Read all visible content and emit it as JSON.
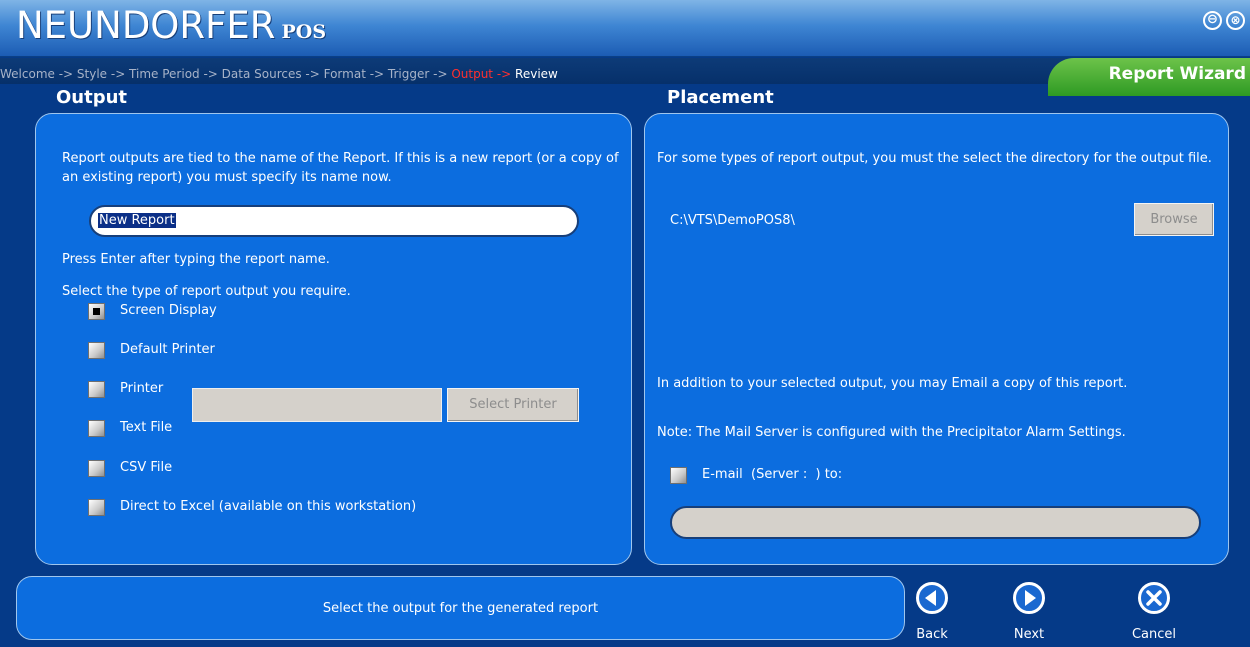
{
  "app": {
    "title": "NEUNDORFER",
    "subtitle": "POS"
  },
  "window_controls": {
    "minimize_glyph": "⊖",
    "close_glyph": "⊗"
  },
  "breadcrumb": {
    "steps_before": "Welcome -> Style -> Time Period -> Data Sources -> Format -> Trigger -> ",
    "current": "Output -> ",
    "after": "Review"
  },
  "wizard_tab": "Report Wizard",
  "output_section": {
    "heading": "Output",
    "intro": "Report outputs are tied to the name of the Report. If this is a new report (or a copy of an existing report) you must specify its name now.",
    "report_name_value": "New Report",
    "hint": "Press Enter after typing the report name.",
    "type_prompt": "Select the type of report output you require.",
    "options": [
      {
        "label": "Screen Display",
        "checked": true
      },
      {
        "label": "Default Printer",
        "checked": false
      },
      {
        "label": "Printer",
        "checked": false
      },
      {
        "label": "Text File",
        "checked": false
      },
      {
        "label": "CSV File",
        "checked": false
      },
      {
        "label": "Direct to Excel (available on this workstation)",
        "checked": false
      }
    ],
    "printer_value": "",
    "select_printer_label": "Select Printer"
  },
  "placement_section": {
    "heading": "Placement",
    "intro": "For some types of report output, you must the select the directory for the output file.",
    "directory": "C:\\VTS\\DemoPOS8\\",
    "browse_label": "Browse",
    "email_intro": "In addition to your selected output, you may Email a copy of this report.",
    "mail_note": "Note: The Mail Server is configured with the Precipitator Alarm Settings.",
    "email_label": "E-mail  (Server :  ) to:",
    "email_checked": false,
    "email_value": ""
  },
  "footer": {
    "status": "Select the output for the generated report",
    "back_label": "Back",
    "next_label": "Next",
    "cancel_label": "Cancel"
  },
  "colors": {
    "panel": "#0c6ddf",
    "background": "#053a88",
    "current_step": "#ff2f2f",
    "wizard_tab": "#2e9a23"
  }
}
